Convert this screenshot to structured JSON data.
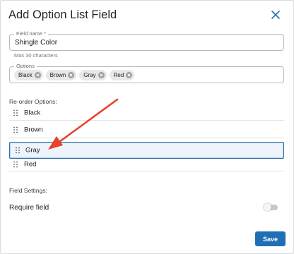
{
  "dialog": {
    "title": "Add Option List Field",
    "close_icon": "close-icon"
  },
  "field_name": {
    "legend": "Field name *",
    "value": "Shingle Color",
    "helper": "Max 30 characters"
  },
  "options": {
    "legend": "Options",
    "chips": [
      "Black",
      "Brown",
      "Gray",
      "Red"
    ]
  },
  "reorder": {
    "label": "Re-order Options:",
    "items": [
      "Black",
      "Brown",
      "Gray",
      "Red"
    ],
    "selected": "Gray",
    "grip_icon": "drag-handle-icon"
  },
  "field_settings": {
    "label": "Field Settings:",
    "require_label": "Require field",
    "require_enabled": false
  },
  "actions": {
    "save_label": "Save"
  },
  "colors": {
    "accent": "#1f6fb5",
    "annotation_arrow": "#e8412c"
  }
}
